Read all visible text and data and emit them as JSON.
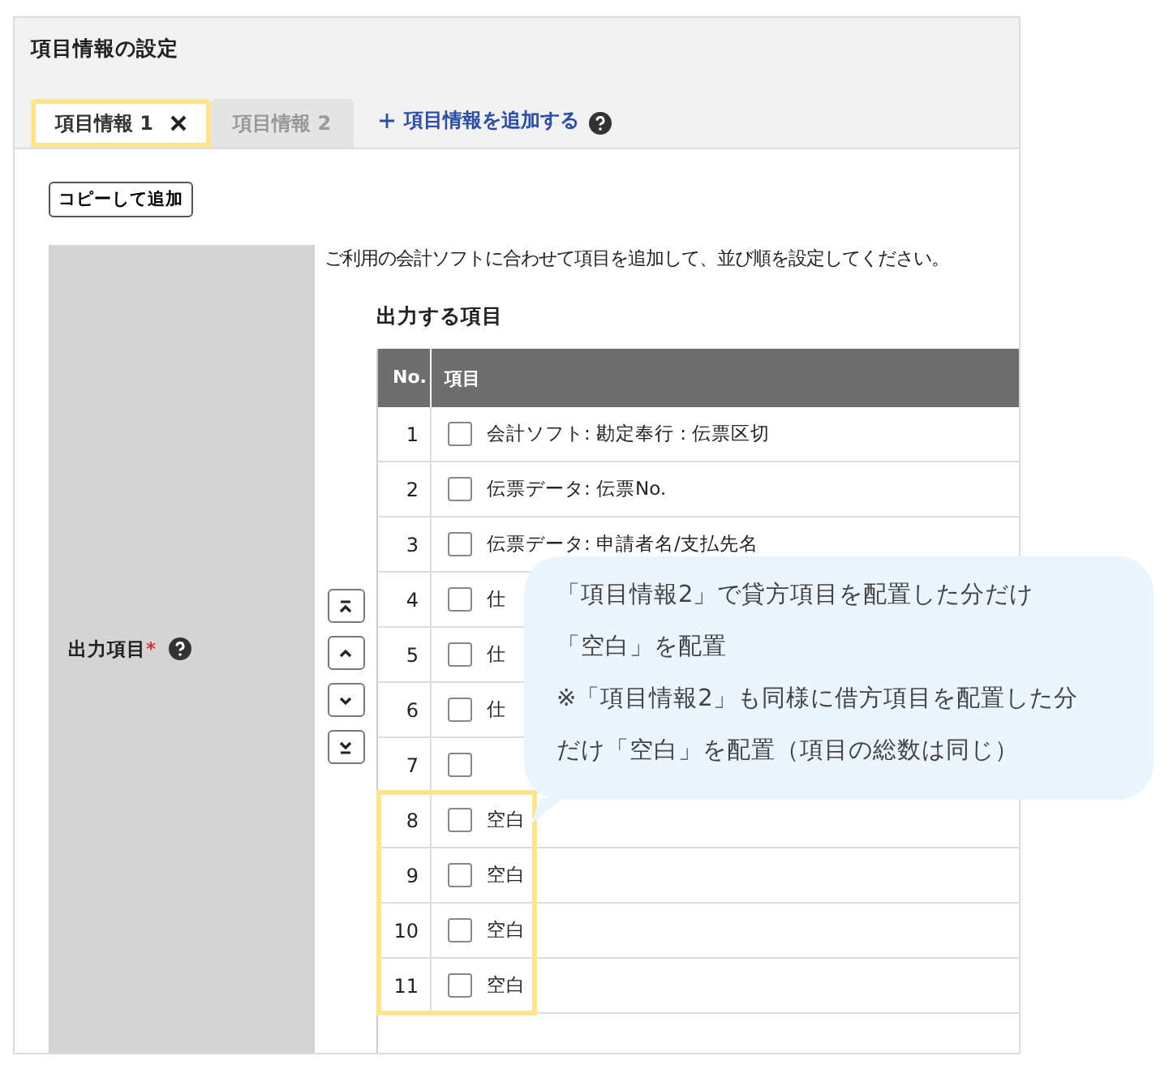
{
  "panel": {
    "title": "項目情報の設定"
  },
  "tabs": [
    {
      "label": "項目情報 1",
      "selected": true,
      "closable": true
    },
    {
      "label": "項目情報 2",
      "selected": false,
      "closable": false
    }
  ],
  "add_link": {
    "label": "項目情報を追加する"
  },
  "copy_button": "コピーして追加",
  "form": {
    "label": "出力項目",
    "required_mark": "*",
    "description": "ご利用の会計ソフトに合わせて項目を追加して、並び順を設定してください。",
    "heading": "出力する項目"
  },
  "table": {
    "columns": [
      "No.",
      "項目"
    ],
    "rows": [
      {
        "no": "1",
        "item": "会計ソフト: 勘定奉行 : 伝票区切",
        "checked": false,
        "highlighted": false
      },
      {
        "no": "2",
        "item": "伝票データ: 伝票No.",
        "checked": false,
        "highlighted": false
      },
      {
        "no": "3",
        "item": "伝票データ: 申請者名/支払先名",
        "checked": false,
        "highlighted": false
      },
      {
        "no": "4",
        "item": "仕",
        "checked": false,
        "highlighted": false
      },
      {
        "no": "5",
        "item": "仕",
        "checked": false,
        "highlighted": false
      },
      {
        "no": "6",
        "item": "仕",
        "checked": false,
        "highlighted": false
      },
      {
        "no": "7",
        "checked": false,
        "highlighted": false
      },
      {
        "no": "8",
        "item": "空白",
        "checked": false,
        "highlighted": true
      },
      {
        "no": "9",
        "item": "空白",
        "checked": false,
        "highlighted": true
      },
      {
        "no": "10",
        "item": "空白",
        "checked": false,
        "highlighted": true
      },
      {
        "no": "11",
        "item": "空白",
        "checked": false,
        "highlighted": true
      }
    ]
  },
  "callout": {
    "lines": [
      "「項目情報2」で貸方項目を配置した分だけ",
      "「空白」を配置",
      "※「項目情報2」も同様に借方項目を配置した分",
      "だけ「空白」を配置（項目の総数は同じ）"
    ]
  }
}
